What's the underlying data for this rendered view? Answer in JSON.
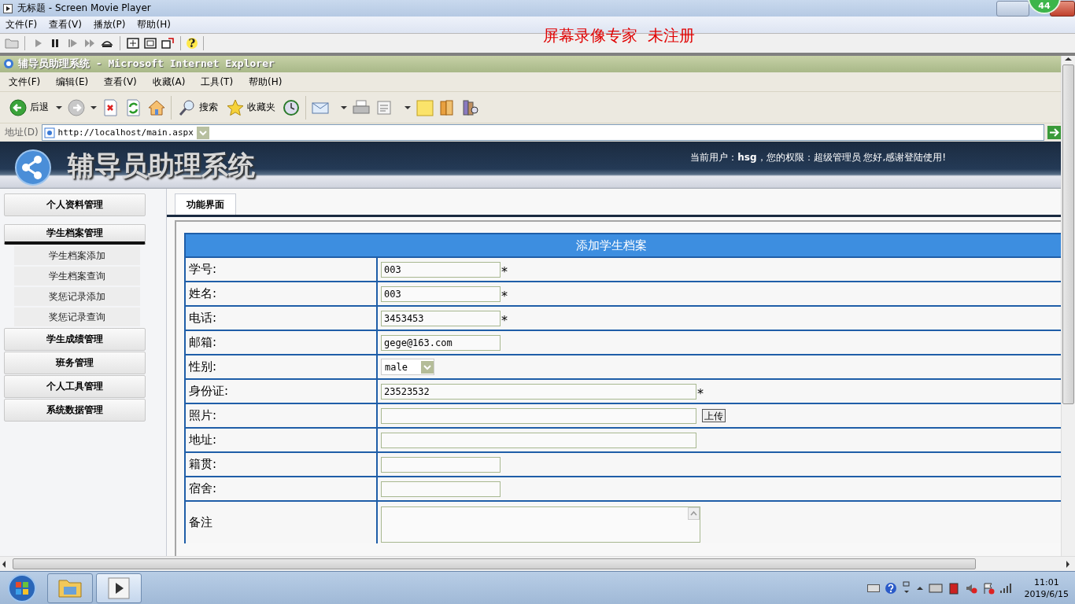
{
  "player": {
    "title": "无标题 - Screen Movie Player",
    "menu": [
      "文件(F)",
      "查看(V)",
      "播放(P)",
      "帮助(H)"
    ],
    "help_glyph": "?",
    "banner": "屏幕录像专家  未注册",
    "badge": "44"
  },
  "browser": {
    "title": "辅导员助理系统 - Microsoft Internet Explorer",
    "menu": [
      "文件(F)",
      "编辑(E)",
      "查看(V)",
      "收藏(A)",
      "工具(T)",
      "帮助(H)"
    ],
    "toolbar": [
      {
        "kind": "back",
        "label": "后退"
      },
      {
        "kind": "forward"
      },
      {
        "kind": "stop"
      },
      {
        "kind": "refresh"
      },
      {
        "kind": "home"
      },
      {
        "kind": "search",
        "label": "搜索"
      },
      {
        "kind": "favorites",
        "label": "收藏夹"
      },
      {
        "kind": "history"
      },
      {
        "kind": "mail"
      },
      {
        "kind": "print"
      },
      {
        "kind": "edit"
      },
      {
        "kind": "note"
      },
      {
        "kind": "books"
      },
      {
        "kind": "research"
      }
    ],
    "address": {
      "label": "地址(D)",
      "value": "http://localhost/main.aspx"
    }
  },
  "page": {
    "header": {
      "title": "辅导员助理系统",
      "user_info": "当前用户：**hsg**，您的权限：超级管理员  您好,感谢登陆使用!"
    },
    "sidebar": [
      {
        "label": "个人资料管理",
        "expanded": false
      },
      {
        "label": "学生档案管理",
        "expanded": true,
        "children": [
          "学生档案添加",
          "学生档案查询",
          "奖惩记录添加",
          "奖惩记录查询"
        ]
      },
      {
        "label": "学生成绩管理",
        "expanded": false
      },
      {
        "label": "班务管理",
        "expanded": false
      },
      {
        "label": "个人工具管理",
        "expanded": false
      },
      {
        "label": "系统数据管理",
        "expanded": false
      }
    ],
    "tabs": [
      {
        "label": "功能界面",
        "selected": true
      }
    ],
    "form": {
      "title": "添加学生档案",
      "fields": [
        {
          "label": "学号:",
          "kind": "text",
          "value": "003",
          "required_mark": "*"
        },
        {
          "label": "姓名:",
          "kind": "text",
          "value": "003",
          "required_mark": "*"
        },
        {
          "label": "电话:",
          "kind": "text",
          "value": "3453453",
          "required_mark": "*"
        },
        {
          "label": "邮箱:",
          "kind": "text",
          "value": "gege@163.com"
        },
        {
          "label": "性别:",
          "kind": "select",
          "value": "male"
        },
        {
          "label": "身份证:",
          "kind": "wide_text",
          "value": "23523532",
          "required_mark": "*"
        },
        {
          "label": "照片:",
          "kind": "file",
          "button": "上传"
        },
        {
          "label": "地址:",
          "kind": "wide_text"
        },
        {
          "label": "籍贯:",
          "kind": "text"
        },
        {
          "label": "宿舍:",
          "kind": "text"
        },
        {
          "label": "备注",
          "kind": "textarea"
        }
      ]
    }
  },
  "taskbar": {
    "apps": [
      {
        "kind": "folder",
        "selected": false
      },
      {
        "kind": "player",
        "selected": true
      }
    ],
    "time": "11:01",
    "date": "2019/6/15"
  }
}
